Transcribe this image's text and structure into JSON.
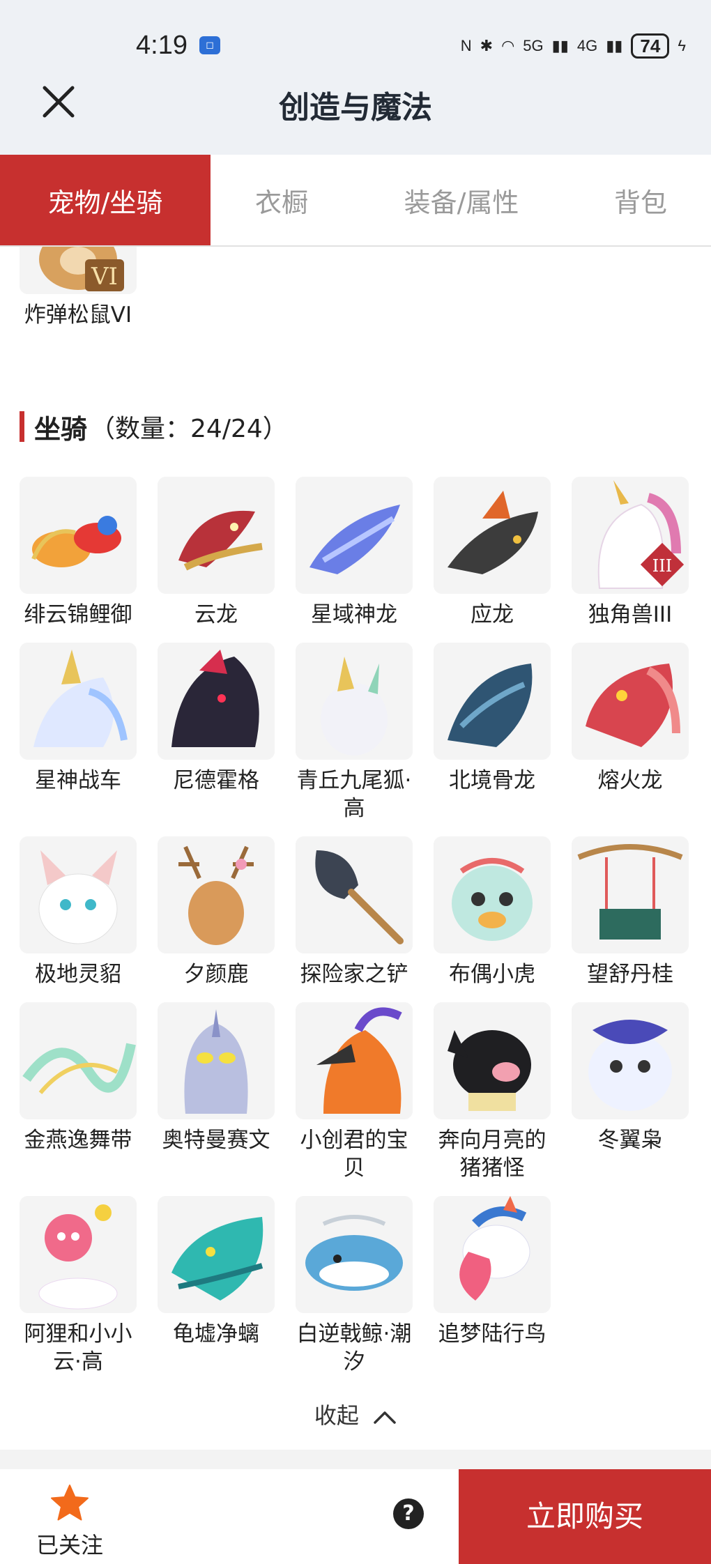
{
  "status_bar": {
    "time": "4:19",
    "app_badge": "",
    "network_5g": "5G",
    "network_4g": "4G",
    "battery": "74"
  },
  "header": {
    "title": "创造与魔法"
  },
  "tabs": [
    {
      "label": "宠物/坐骑",
      "active": true
    },
    {
      "label": "衣橱",
      "active": false
    },
    {
      "label": "装备/属性",
      "active": false
    },
    {
      "label": "背包",
      "active": false
    }
  ],
  "pet_partial": {
    "name": "炸弹松鼠VI",
    "badge": "VI"
  },
  "mounts_section": {
    "title": "坐骑",
    "count": "（数量：24/24）"
  },
  "mounts": [
    {
      "name": "绯云锦鲤御",
      "icon": "koi-mount-icon"
    },
    {
      "name": "云龙",
      "icon": "cloud-dragon-icon"
    },
    {
      "name": "星域神龙",
      "icon": "star-dragon-icon"
    },
    {
      "name": "应龙",
      "icon": "winged-dragon-icon"
    },
    {
      "name": "独角兽III",
      "icon": "unicorn-icon",
      "badge": "III"
    },
    {
      "name": "星神战车",
      "icon": "star-chariot-icon"
    },
    {
      "name": "尼德霍格",
      "icon": "nidhogg-icon"
    },
    {
      "name": "青丘九尾狐·高",
      "icon": "nine-tail-fox-icon"
    },
    {
      "name": "北境骨龙",
      "icon": "bone-dragon-icon"
    },
    {
      "name": "熔火龙",
      "icon": "lava-dragon-icon"
    },
    {
      "name": "极地灵貂",
      "icon": "polar-ferret-icon"
    },
    {
      "name": "夕颜鹿",
      "icon": "deer-icon"
    },
    {
      "name": "探险家之铲",
      "icon": "shovel-icon"
    },
    {
      "name": "布偶小虎",
      "icon": "plush-tiger-icon"
    },
    {
      "name": "望舒丹桂",
      "icon": "swing-icon"
    },
    {
      "name": "金燕逸舞带",
      "icon": "ribbon-icon"
    },
    {
      "name": "奥特曼赛文",
      "icon": "ultraman-icon"
    },
    {
      "name": "小创君的宝贝",
      "icon": "phoenix-icon"
    },
    {
      "name": "奔向月亮的猪猪怪",
      "icon": "pig-icon"
    },
    {
      "name": "冬翼枭",
      "icon": "owl-icon"
    },
    {
      "name": "阿狸和小小云·高",
      "icon": "ali-fox-icon"
    },
    {
      "name": "龟墟净螭",
      "icon": "turtle-dragon-icon"
    },
    {
      "name": "白逆戟鲸·潮汐",
      "icon": "orca-icon"
    },
    {
      "name": "追梦陆行鸟",
      "icon": "dream-bird-icon"
    }
  ],
  "collapse": {
    "label": "收起"
  },
  "bottom_bar": {
    "follow_label": "已关注",
    "help": "?",
    "buy_label": "立即购买"
  },
  "colors": {
    "accent": "#c7302f",
    "header_bg": "#eef1f5",
    "star": "#f26a1b"
  }
}
